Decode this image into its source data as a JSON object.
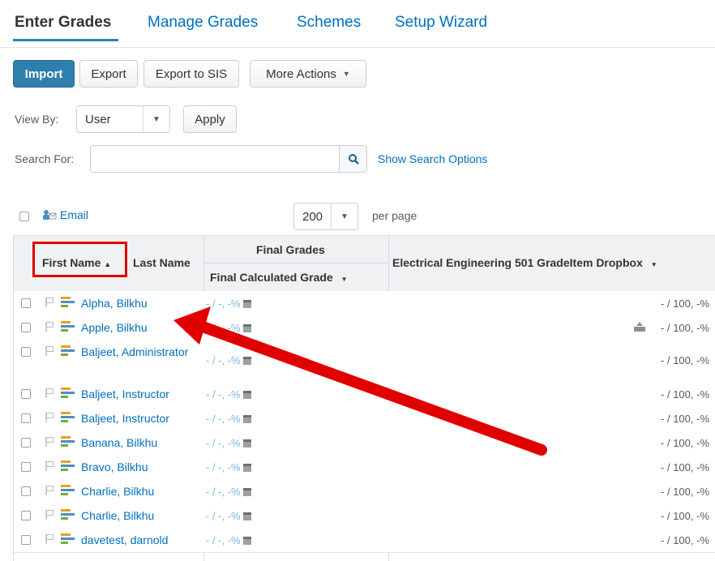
{
  "tabs": [
    {
      "label": "Enter Grades",
      "active": true
    },
    {
      "label": "Manage Grades"
    },
    {
      "label": "Schemes"
    },
    {
      "label": "Setup Wizard"
    }
  ],
  "toolbar": {
    "import": "Import",
    "export": "Export",
    "export_sis": "Export to SIS",
    "more_actions": "More Actions"
  },
  "view_by": {
    "label": "View By:",
    "value": "User",
    "apply": "Apply"
  },
  "search": {
    "label": "Search For:",
    "value": "",
    "show_options": "Show Search Options"
  },
  "list_controls": {
    "email": "Email",
    "per_page_value": "200",
    "per_page_label": "per page"
  },
  "table": {
    "headers": {
      "first_name": "First Name",
      "last_name": "Last Name",
      "final_grades": "Final Grades",
      "final_calculated": "Final Calculated Grade",
      "dropbox": "Electrical Engineering 501 GradeItem Dropbox"
    },
    "rows": [
      {
        "name": "Alpha, Bilkhu",
        "grade": "- / -, -%",
        "score": "- / 100, -%"
      },
      {
        "name": "Apple, Bilkhu",
        "grade": "- / -, -%",
        "score": "- / 100, -%",
        "has_dropbox_icon": true
      },
      {
        "name": "Baljeet, Administrator",
        "grade": "- / -, -%",
        "score": "- / 100, -%"
      },
      {
        "name": "Baljeet, Instructor",
        "grade": "- / -, -%",
        "score": "- / 100, -%"
      },
      {
        "name": "Baljeet, Instructor",
        "grade": "- / -, -%",
        "score": "- / 100, -%"
      },
      {
        "name": "Banana, Bilkhu",
        "grade": "- / -, -%",
        "score": "- / 100, -%"
      },
      {
        "name": "Bravo, Bilkhu",
        "grade": "- / -, -%",
        "score": "- / 100, -%"
      },
      {
        "name": "Charlie, Bilkhu",
        "grade": "- / -, -%",
        "score": "- / 100, -%"
      },
      {
        "name": "Charlie, Bilkhu",
        "grade": "- / -, -%",
        "score": "- / 100, -%"
      },
      {
        "name": "davetest, darnold",
        "grade": "- / -, -%",
        "score": "- / 100, -%"
      }
    ]
  },
  "colors": {
    "link": "#006fbf",
    "primary_button": "#2e7fae",
    "annotation": "#e00000"
  }
}
